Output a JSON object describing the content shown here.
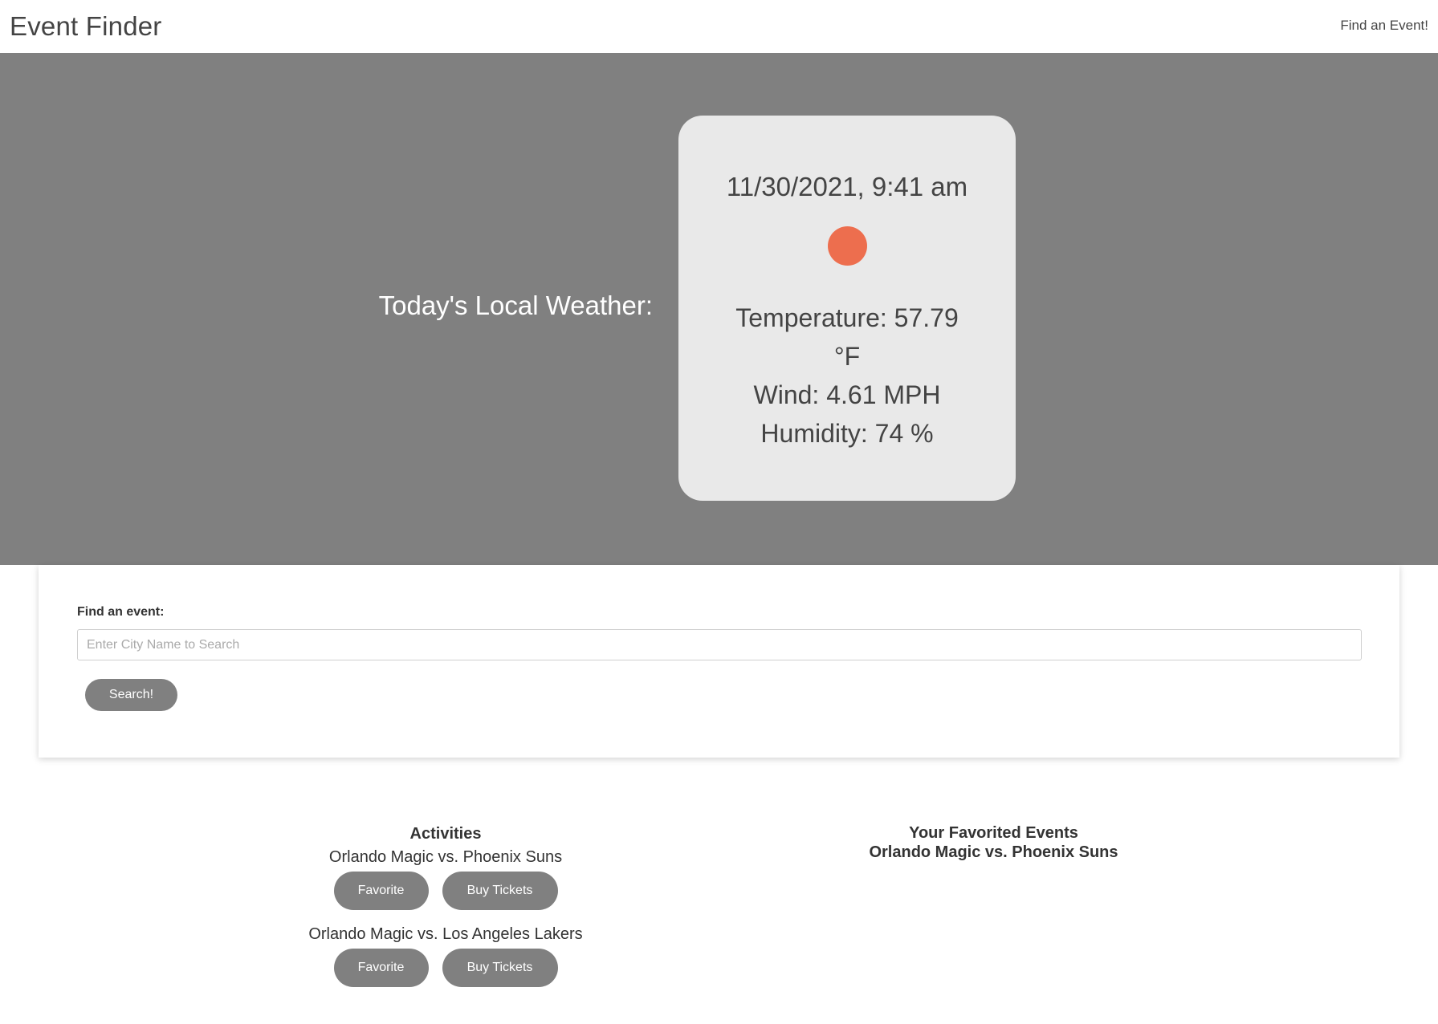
{
  "navbar": {
    "brand": "Event Finder",
    "link": "Find an Event!"
  },
  "weather": {
    "heading": "Today's Local Weather:",
    "datetime": "11/30/2021, 9:41 am",
    "icon": "sun-icon",
    "icon_color": "#ED6E4E",
    "temperature": "Temperature: 57.79",
    "temperature_unit": "°F",
    "wind": "Wind: 4.61 MPH",
    "humidity": "Humidity: 74 %"
  },
  "search": {
    "label": "Find an event:",
    "placeholder": "Enter City Name to Search",
    "value": "",
    "button_label": "Search!"
  },
  "activities": {
    "title": "Activities",
    "items": [
      {
        "name": "Orlando Magic vs. Phoenix Suns",
        "favorite_label": "Favorite",
        "buy_label": "Buy Tickets"
      },
      {
        "name": "Orlando Magic vs. Los Angeles Lakers",
        "favorite_label": "Favorite",
        "buy_label": "Buy Tickets"
      }
    ]
  },
  "favorites": {
    "title": "Your Favorited Events",
    "items": [
      "Orlando Magic vs. Phoenix Suns"
    ]
  },
  "colors": {
    "hero_background": "#808080",
    "card_background": "#E9E9E9",
    "button_background": "#808080"
  }
}
